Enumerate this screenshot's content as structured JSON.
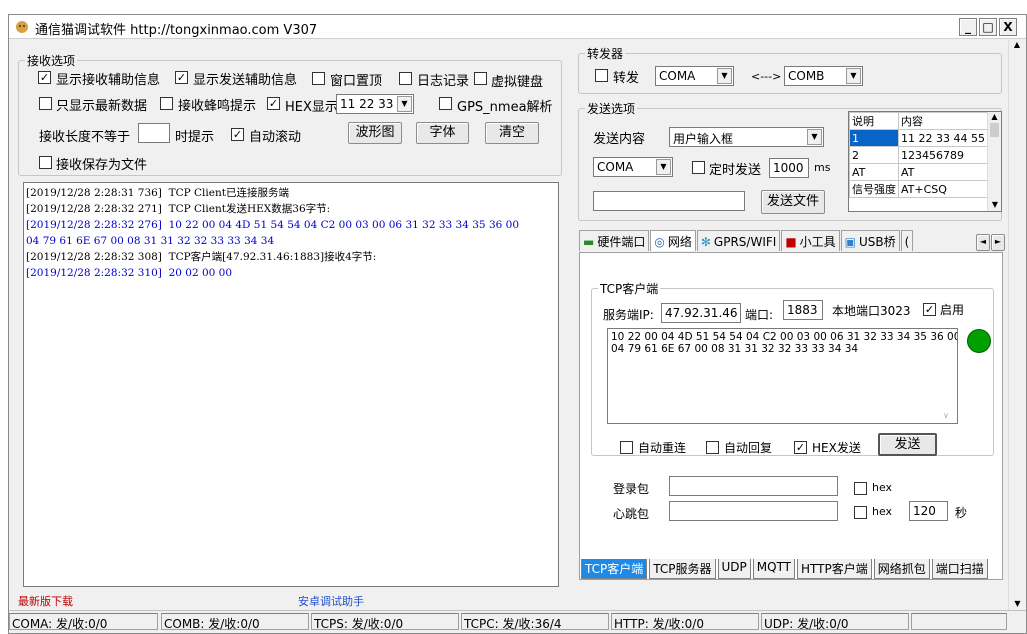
{
  "window": {
    "title": "通信猫调试软件  http://tongxinmao.com  V307",
    "min": "_",
    "max": "□",
    "close": "X"
  },
  "recv_options": {
    "legend": "接收选项",
    "show_recv_aux": "显示接收辅助信息",
    "show_send_aux": "显示发送辅助信息",
    "topmost": "窗口置顶",
    "log": "日志记录",
    "virtual_kb": "虚拟键盘",
    "latest_only": "只显示最新数据",
    "beep": "接收蜂鸣提示",
    "hex_display": "HEX显示",
    "hex_value": "11 22 33",
    "gps": "GPS_nmea解析",
    "len_prefix": "接收长度不等于",
    "len_suffix": "时提示",
    "autoscroll": "自动滚动",
    "save_file": "接收保存为文件",
    "btn_wave": "波形图",
    "btn_font": "字体",
    "btn_clear": "清空"
  },
  "log_lines": [
    {
      "text": "[2019/12/28 2:28:31 736]  TCP Client已连接服务端",
      "color": "black"
    },
    {
      "text": "[2019/12/28 2:28:32 271]  TCP Client发送HEX数据36字节:",
      "color": "black"
    },
    {
      "text": "[2019/12/28 2:28:32 276]  10 22 00 04 4D 51 54 54 04 C2 00 03 00 06 31 32 33 34 35 36 00",
      "color": "blue"
    },
    {
      "text": "04 79 61 6E 67 00 08 31 31 32 32 33 33 34 34",
      "color": "blue"
    },
    {
      "text": "[2019/12/28 2:28:32 308]  TCP客户端[47.92.31.46:1883]接收4字节:",
      "color": "black"
    },
    {
      "text": "[2019/12/28 2:28:32 310]  20 02 00 00",
      "color": "blue"
    }
  ],
  "links": {
    "latest": "最新版下载",
    "android": "安卓调试助手"
  },
  "forwarder": {
    "legend": "转发器",
    "label": "转发",
    "from": "COMA",
    "arrow": "<--->",
    "to": "COMB"
  },
  "send_options": {
    "legend": "发送选项",
    "content_label": "发送内容",
    "content_value": "用户输入框",
    "port": "COMA",
    "timed": "定时发送",
    "interval": "1000",
    "unit": "ms",
    "send_file": "发送文件",
    "table_headers": [
      "说明",
      "内容"
    ],
    "table_rows": [
      [
        "1",
        "11 22 33 44 55"
      ],
      [
        "2",
        "123456789"
      ],
      [
        "AT",
        "AT"
      ],
      [
        "信号强度",
        "AT+CSQ"
      ]
    ]
  },
  "top_tabs": [
    "硬件端口",
    "网络",
    "GPRS/WIFI",
    "小工具",
    "USB桥",
    "("
  ],
  "tcp_client": {
    "legend": "TCP客户端",
    "server_ip_label": "服务端IP:",
    "server_ip": "47.92.31.46",
    "port_label": "端口:",
    "port": "1883",
    "local_port": "本地端口3023",
    "enable": "启用",
    "status_color": "#00a000",
    "text": "10 22 00 04 4D 51 54 54 04 C2 00 03 00 06 31 32 33 34 35 36 00\n04 79 61 6E 67 00 08 31 31 32 32 33 33 34 34",
    "auto_reconnect": "自动重连",
    "auto_reply": "自动回复",
    "hex_send": "HEX发送",
    "send": "发送",
    "login_label": "登录包",
    "heartbeat_label": "心跳包",
    "hex": "hex",
    "heartbeat_interval": "120",
    "sec": "秒"
  },
  "bottom_tabs": [
    "TCP客户端",
    "TCP服务器",
    "UDP",
    "MQTT",
    "HTTP客户端",
    "网络抓包",
    "端口扫描"
  ],
  "status_bar": [
    "COMA: 发/收:0/0",
    "COMB: 发/收:0/0",
    "TCPS: 发/收:0/0",
    "TCPC: 发/收:36/4",
    "HTTP: 发/收:0/0",
    "UDP: 发/收:0/0"
  ]
}
